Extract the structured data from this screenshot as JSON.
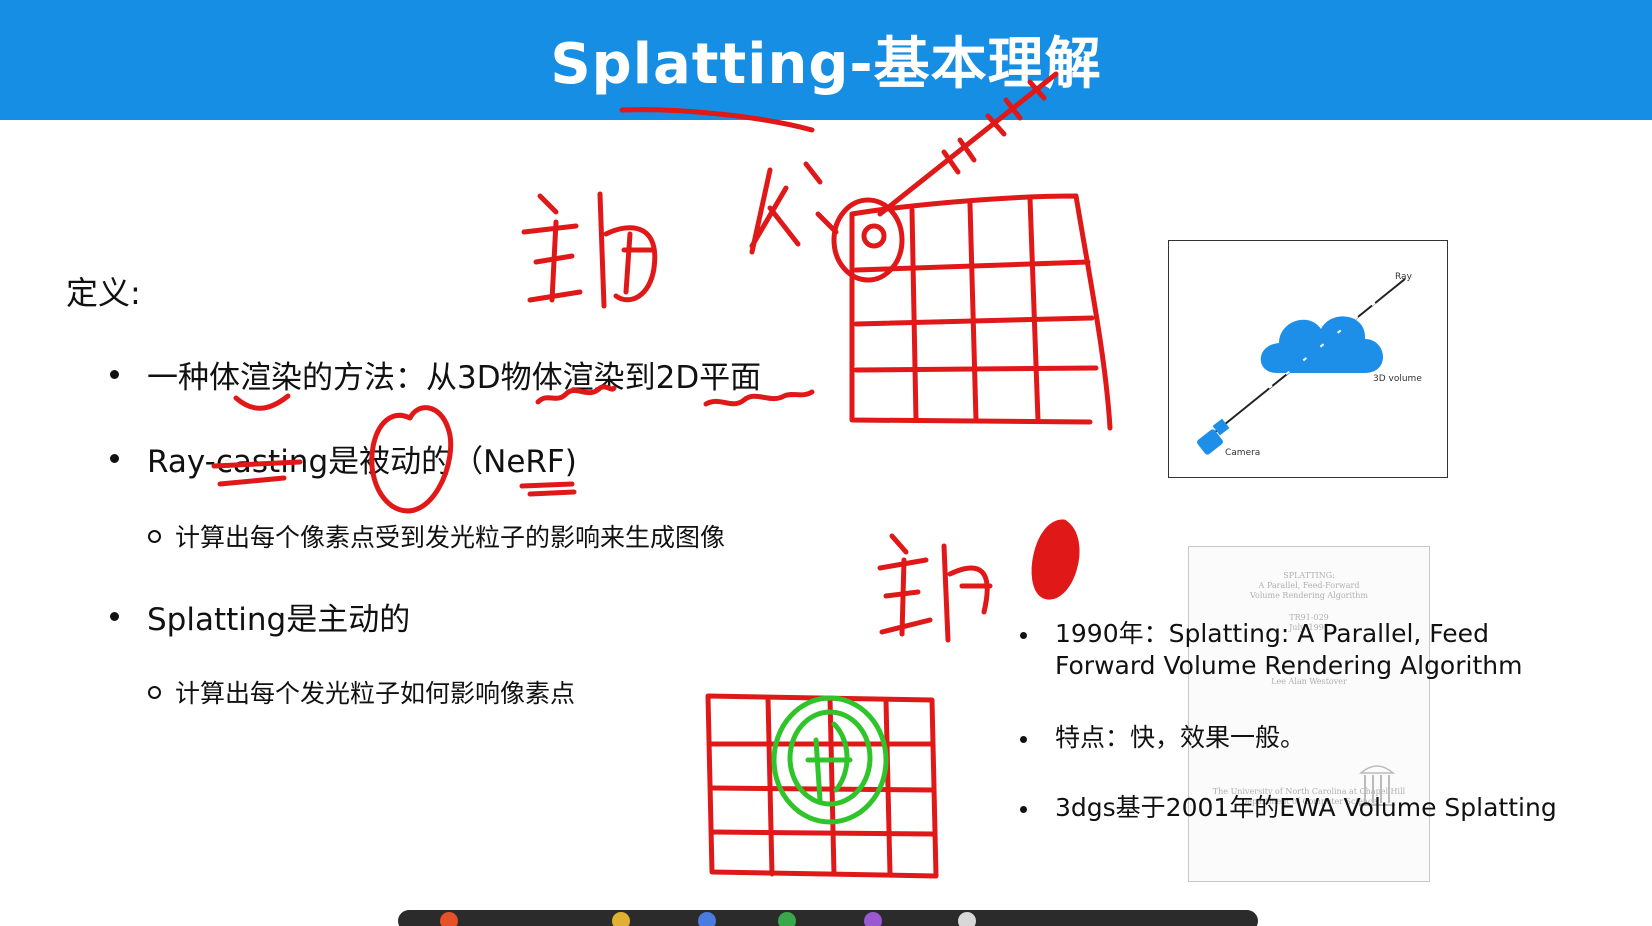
{
  "header": {
    "title": "Splatting-基本理解"
  },
  "definition": {
    "label": "定义:"
  },
  "bullets": [
    {
      "text": "一种体渲染的方法：从3D物体渲染到2D平面"
    },
    {
      "text": "Ray-casting是被动的（NeRF)"
    },
    {
      "text": "Splatting是主动的"
    }
  ],
  "sub_bullets": [
    {
      "text": "计算出每个像素点受到发光粒子的影响来生成图像"
    },
    {
      "text": "计算出每个发光粒子如何影响像素点"
    }
  ],
  "ray_figure": {
    "ray_label": "Ray",
    "volume_label": "3D volume",
    "camera_label": "Camera",
    "cloud_color": "#1e8fe8",
    "camera_color": "#1e8fe8"
  },
  "paper_thumbnail": {
    "lines": [
      "SPLATTING:",
      "A Parallel, Feed-Forward",
      "Volume Rendering Algorithm",
      "TR91-029",
      "July, 1991",
      "Lee Alan Westover"
    ],
    "footer": [
      "The University of North Carolina at Chapel Hill",
      "Department of Computer Science"
    ]
  },
  "right_bullets": [
    {
      "text": "1990年：Splatting: A Parallel, Feed Forward Volume Rendering Algorithm"
    },
    {
      "text": "特点：快，效果一般。"
    },
    {
      "text": "3dgs基于2001年的EWA Volume Splatting"
    }
  ],
  "colors": {
    "header_bg": "#168ee3",
    "annotation_red": "#e01818",
    "annotation_green": "#2fc52a"
  }
}
